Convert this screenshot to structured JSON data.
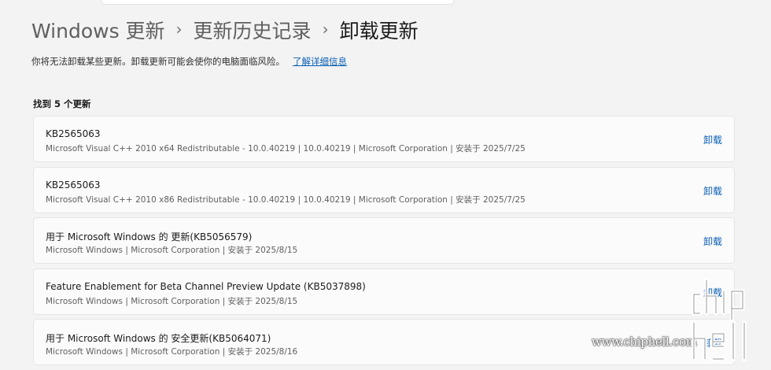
{
  "breadcrumb": {
    "items": [
      "Windows 更新",
      "更新历史记录",
      "卸载更新"
    ],
    "separator": "›"
  },
  "description": {
    "text": "你将无法卸载某些更新。卸载更新可能会使你的电脑面临风险。",
    "link": "了解详细信息"
  },
  "found_count": "找到 5 个更新",
  "updates": [
    {
      "title": "KB2565063",
      "meta": "Microsoft Visual C++ 2010  x64 Redistributable - 10.0.40219  |  10.0.40219  |  Microsoft Corporation  |  安装于 2025/7/25",
      "action": "卸载"
    },
    {
      "title": "KB2565063",
      "meta": "Microsoft Visual C++ 2010  x86 Redistributable - 10.0.40219  |  10.0.40219  |  Microsoft Corporation  |  安装于 2025/7/25",
      "action": "卸载"
    },
    {
      "title": "用于 Microsoft Windows 的 更新(KB5056579)",
      "meta": "Microsoft Windows  |  Microsoft Corporation  |  安装于 2025/8/15",
      "action": "卸载"
    },
    {
      "title": "Feature Enablement for Beta Channel Preview Update (KB5037898)",
      "meta": "Microsoft Windows  |  Microsoft Corporation  |  安装于 2025/8/15",
      "action": "卸载"
    },
    {
      "title": "用于 Microsoft Windows 的 安全更新(KB5064071)",
      "meta": "Microsoft Windows  |  Microsoft Corporation  |  安装于 2025/8/16",
      "action": "卸载"
    }
  ],
  "watermark": {
    "site": "www.chiphell.com",
    "logo_text": "chiphell"
  },
  "colors": {
    "background": "#f3f3f3",
    "card": "#fbfbfb",
    "link": "#0a5fb4"
  }
}
